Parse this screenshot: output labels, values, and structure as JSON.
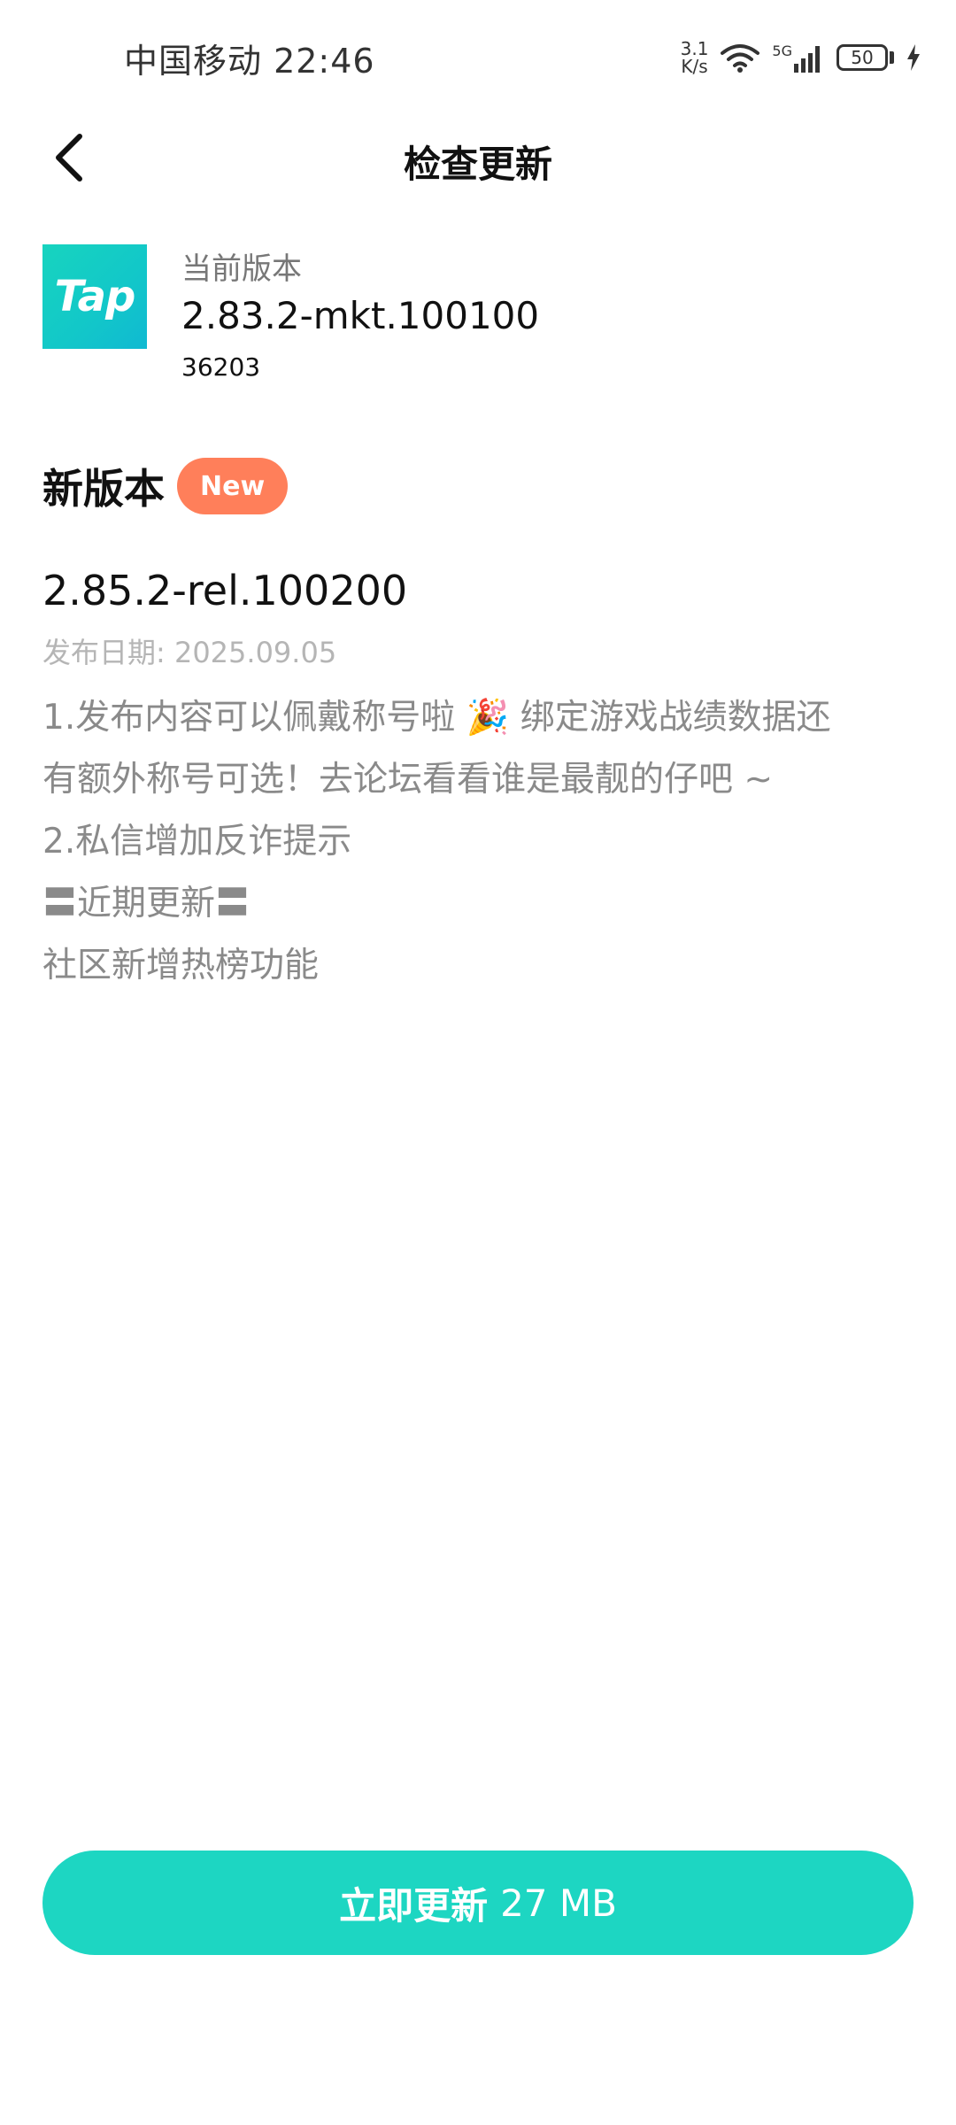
{
  "status_bar": {
    "carrier_time": "中国移动 22:46",
    "net_speed_value": "3.1",
    "net_speed_unit": "K/s",
    "signal_type": "5G",
    "battery_level": "50"
  },
  "header": {
    "title": "检查更新",
    "back_icon": "chevron-left-icon"
  },
  "current_version": {
    "app_icon_text": "Tap",
    "label": "当前版本",
    "version": "2.83.2-mkt.100100",
    "build": "36203"
  },
  "new_version": {
    "heading": "新版本",
    "badge": "New",
    "version": "2.85.2-rel.100200",
    "release_date": "发布日期: 2025.09.05",
    "notes": [
      "1.发布内容可以佩戴称号啦 🎉 绑定游戏战绩数据还",
      "有额外称号可选！去论坛看看谁是最靓的仔吧 ~",
      "2.私信增加反诈提示",
      "〓近期更新〓",
      "社区新增热榜功能"
    ]
  },
  "update_button": {
    "label": "立即更新",
    "size": "27 MB"
  },
  "colors": {
    "accent": "#1dd6c2",
    "badge": "#ff7f5a",
    "muted_text": "#8a8a8a",
    "date_text": "#b5b5b5"
  }
}
